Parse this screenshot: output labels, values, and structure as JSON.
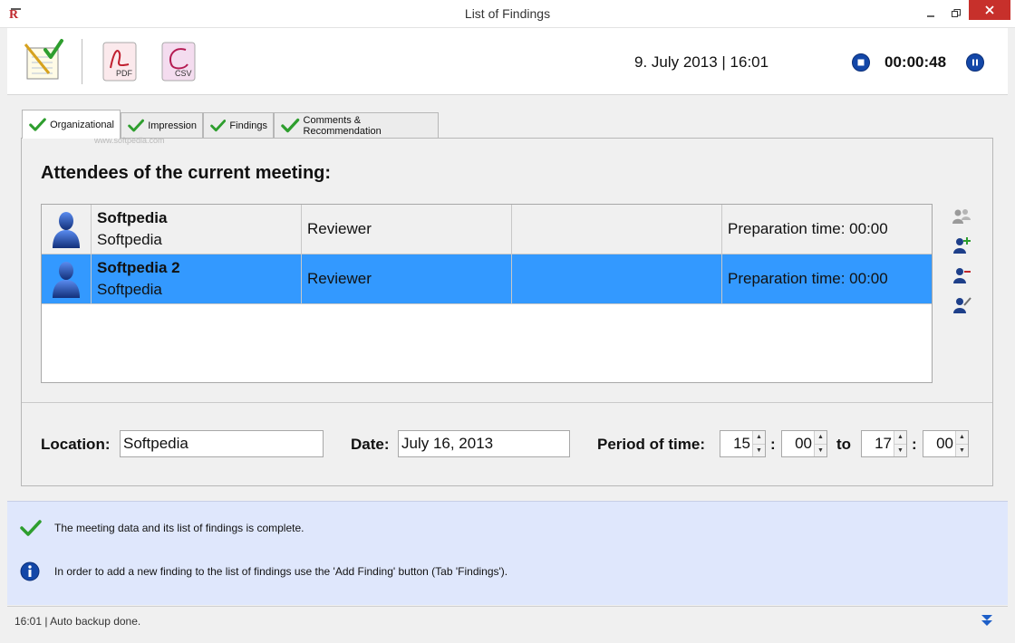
{
  "window": {
    "title": "List of Findings"
  },
  "toolbar": {
    "pdf_label": "PDF",
    "csv_label": "CSV",
    "datetime": "9. July 2013 | 16:01",
    "timer": "00:00:48"
  },
  "tabs": [
    {
      "label": "Organizational"
    },
    {
      "label": "Impression"
    },
    {
      "label": "Findings"
    },
    {
      "label": "Comments & Recommendation"
    }
  ],
  "watermark": "www.softpedia.com",
  "meeting": {
    "heading": "Attendees of the current meeting:",
    "attendees": [
      {
        "name": "Softpedia",
        "organization": "Softpedia",
        "role": "Reviewer",
        "extra": "",
        "prep": "Preparation time: 00:00"
      },
      {
        "name": "Softpedia 2",
        "organization": "Softpedia",
        "role": "Reviewer",
        "extra": "",
        "prep": "Preparation time: 00:00"
      }
    ],
    "location_label": "Location:",
    "location_value": "Softpedia",
    "date_label": "Date:",
    "date_value": "July 16, 2013",
    "period_label": "Period of time:",
    "start_hour": "15",
    "start_minute": "00",
    "to_label": "to",
    "end_hour": "17",
    "end_minute": "00",
    "colon": ":"
  },
  "info": {
    "complete_msg": "The meeting data and its list of findings is complete.",
    "hint_msg": "In order to add a new finding to the list of findings use the 'Add Finding' button (Tab 'Findings')."
  },
  "status": {
    "text": "16:01 | Auto backup done."
  },
  "colors": {
    "selection": "#3399ff",
    "info_bg": "#dfe7fc",
    "check_green": "#2e9e2e",
    "accent_blue": "#1347a8"
  }
}
